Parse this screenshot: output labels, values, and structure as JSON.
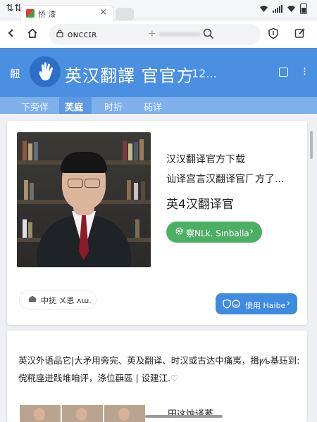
{
  "status_bar": {
    "left_glyph": "⇅⇅"
  },
  "browser_tab": {
    "title": "㤭 漆"
  },
  "address_bar": {
    "url": "ᴏɴccɪʀ"
  },
  "banner": {
    "left_text": "䶊",
    "title": "英汉翻譯 官官方",
    "number": "12..."
  },
  "nav_tabs": [
    "下旁伴",
    "芙庭",
    "时折",
    "砳详"
  ],
  "app_card": {
    "line1": "汉汉翻译官方下载",
    "line2": "讪译宫言汉翻译官⺁方了...",
    "line3": "英4汉翻译官",
    "green_button": "察NLk. Sınballa",
    "tag_text": "中抚 ㄨ恩 ᴧɯ.",
    "blue_button": "偾用 Haibe"
  },
  "description": {
    "text": "英汉外语品它|大矛用旁完、英及翻译、时汉或古达中痛夷，揖ꝩ⁄ь基珏到: 傥糀座迸践堆咱评，涤位蕻區 | 设建江."
  },
  "bottom": {
    "label": "田这蚀译莃"
  }
}
